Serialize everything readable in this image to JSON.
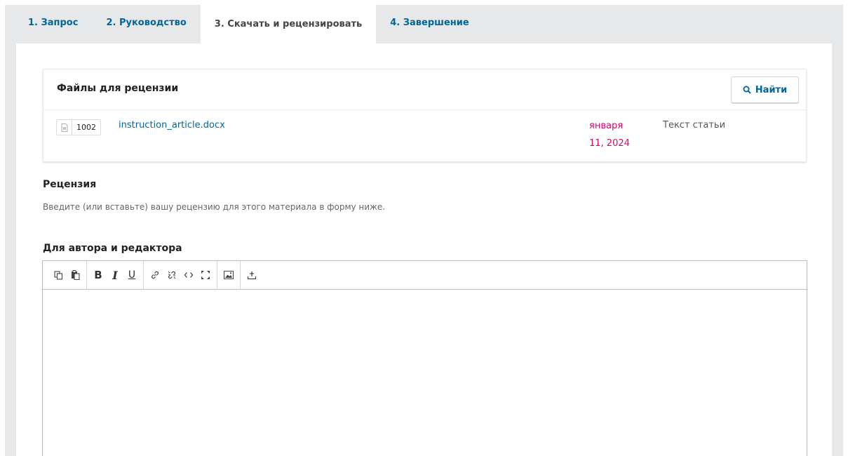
{
  "tabs": [
    {
      "label": "1. Запрос",
      "active": false
    },
    {
      "label": "2. Руководство",
      "active": false
    },
    {
      "label": "3. Скачать и рецензировать",
      "active": true
    },
    {
      "label": "4. Завершение",
      "active": false
    }
  ],
  "files": {
    "title": "Файлы для рецензии",
    "search_label": "Найти",
    "rows": [
      {
        "id": "1002",
        "name": "instruction_article.docx",
        "date_line1": "января",
        "date_line2": "11, 2024",
        "type": "Текст статьи",
        "icon": "word-doc-icon"
      }
    ]
  },
  "review": {
    "label": "Рецензия",
    "description": "Введите (или вставьте) вашу рецензию для этого материала в форму ниже."
  },
  "editor": {
    "label": "Для автора и редактора",
    "value": "",
    "toolbar": {
      "bold": "B",
      "italic": "I",
      "underline": "U"
    }
  },
  "colors": {
    "link": "#006798",
    "date": "#d00a6c",
    "background": "#e6e8ea"
  }
}
